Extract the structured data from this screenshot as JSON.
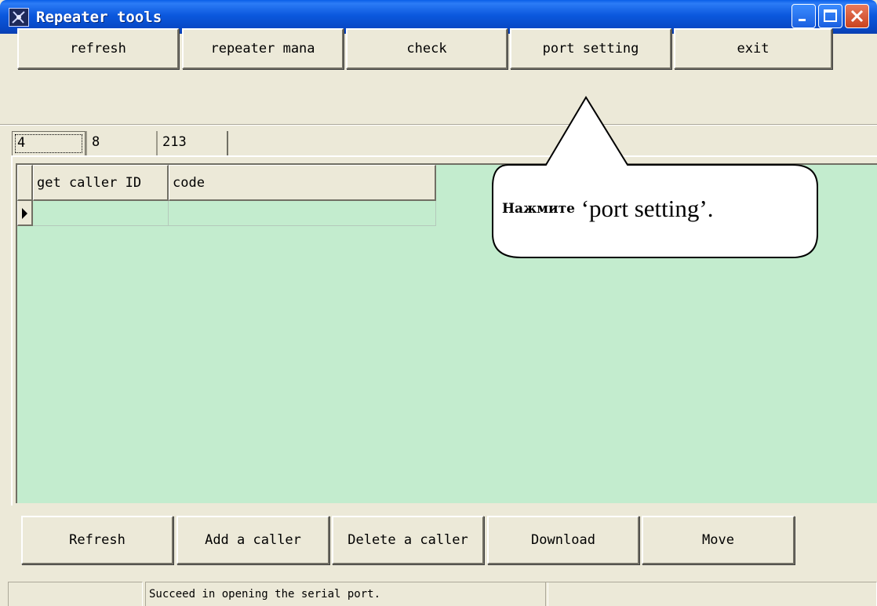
{
  "window": {
    "title": "Repeater tools",
    "controls": {
      "minimize": "minimize-icon",
      "maximize": "maximize-icon",
      "close": "close-icon"
    }
  },
  "toolbar": {
    "buttons": [
      "refresh",
      "repeater mana",
      "check",
      "port setting",
      "exit"
    ]
  },
  "tabs": [
    "4",
    "8",
    "213"
  ],
  "grid": {
    "columns": [
      "get caller ID",
      "code"
    ],
    "rows": [
      [
        "",
        ""
      ]
    ],
    "background": "#c3ecce"
  },
  "callout": {
    "prefix": "Нажмите",
    "text": " ‘port setting’."
  },
  "bottom_buttons": [
    "Refresh",
    "Add a caller",
    "Delete a caller",
    "Download",
    "Move"
  ],
  "status": {
    "panels": [
      "",
      "Succeed in opening the serial port.",
      ""
    ]
  },
  "colors": {
    "titlebar": "#0b58de",
    "face": "#ece9d8",
    "grid": "#c3ecce",
    "close": "#c9431f"
  }
}
